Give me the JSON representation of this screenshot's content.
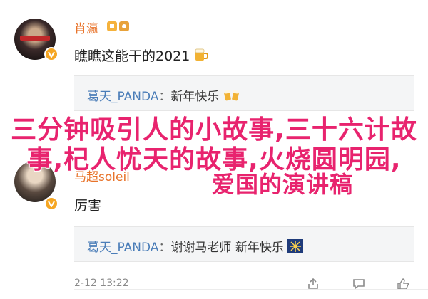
{
  "comments": [
    {
      "username": "肖瀛",
      "text": "瞧瞧这能干的2021",
      "text_emoji": "beer-mug-emoji",
      "reply": {
        "user": "葛天_PANDA",
        "colon": "：",
        "text": "新年快乐",
        "emoji": "beer-cheers-emoji"
      }
    },
    {
      "username": "马超soleil",
      "text": "厉害",
      "reply": {
        "user": "葛天_PANDA",
        "colon": "：",
        "text": "谢谢马老师 新年快乐",
        "emoji": "fireworks-emoji"
      },
      "meta": {
        "date": "2-12 13:22",
        "share_icon": "share-icon",
        "comment_icon": "comment-icon",
        "like_icon": "like-icon"
      }
    }
  ],
  "overlay": {
    "line1": "三分钟吸引人的小故事,三十六计故",
    "line2": "事,杞人忧天的故事,火烧圆明园,",
    "line3": "爱国的演讲稿"
  },
  "colors": {
    "username": "#e8732a",
    "reply_user": "#4a7db8",
    "overlay": "#e8236e",
    "badge": "#f5a623"
  }
}
